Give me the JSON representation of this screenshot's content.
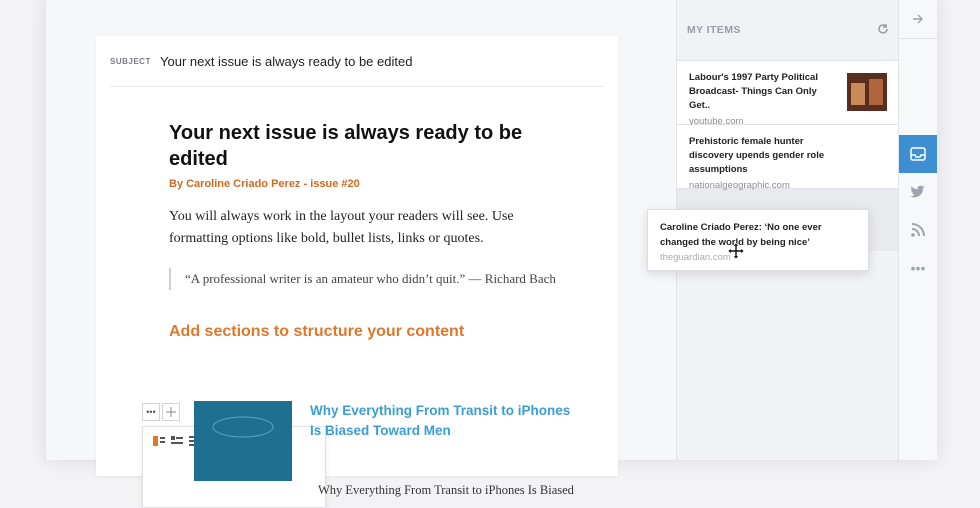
{
  "subject": {
    "label": "SUBJECT",
    "value": "Your next issue is always ready to be edited"
  },
  "article": {
    "title": "Your next issue is always ready to be edited",
    "byline": "By Caroline Criado Perez - issue #20",
    "body": "You will always work in the layout your readers will see. Use formatting options like bold, bullet lists, links or quotes.",
    "quote": "“A professional writer is an amateur who didn’t quit.” — Richard Bach",
    "section_heading": "Add sections to structure your content",
    "link_title": "Why Everything From Transit to iPhones Is Biased Toward Men",
    "link_desc": "Why Everything From Transit to iPhones Is Biased"
  },
  "sidebar": {
    "title": "MY ITEMS",
    "items": [
      {
        "title": "Labour's 1997 Party Political Broadcast- Things Can Only Get..",
        "source": "youtube.com"
      },
      {
        "title": "Prehistoric female hunter discovery upends gender role assumptions",
        "source": "nationalgeographic.com"
      }
    ]
  },
  "drag_card": {
    "title": "Caroline Criado Perez: ‘No one ever changed the world by being nice’",
    "source": "theguardian.com"
  },
  "rail": {
    "icons": [
      "arrow-right-icon",
      "inbox-icon",
      "twitter-icon",
      "rss-icon",
      "more-icon"
    ]
  },
  "colors": {
    "accent": "#3d8fd1",
    "orange": "#e0782c",
    "link": "#3a9fd6"
  }
}
